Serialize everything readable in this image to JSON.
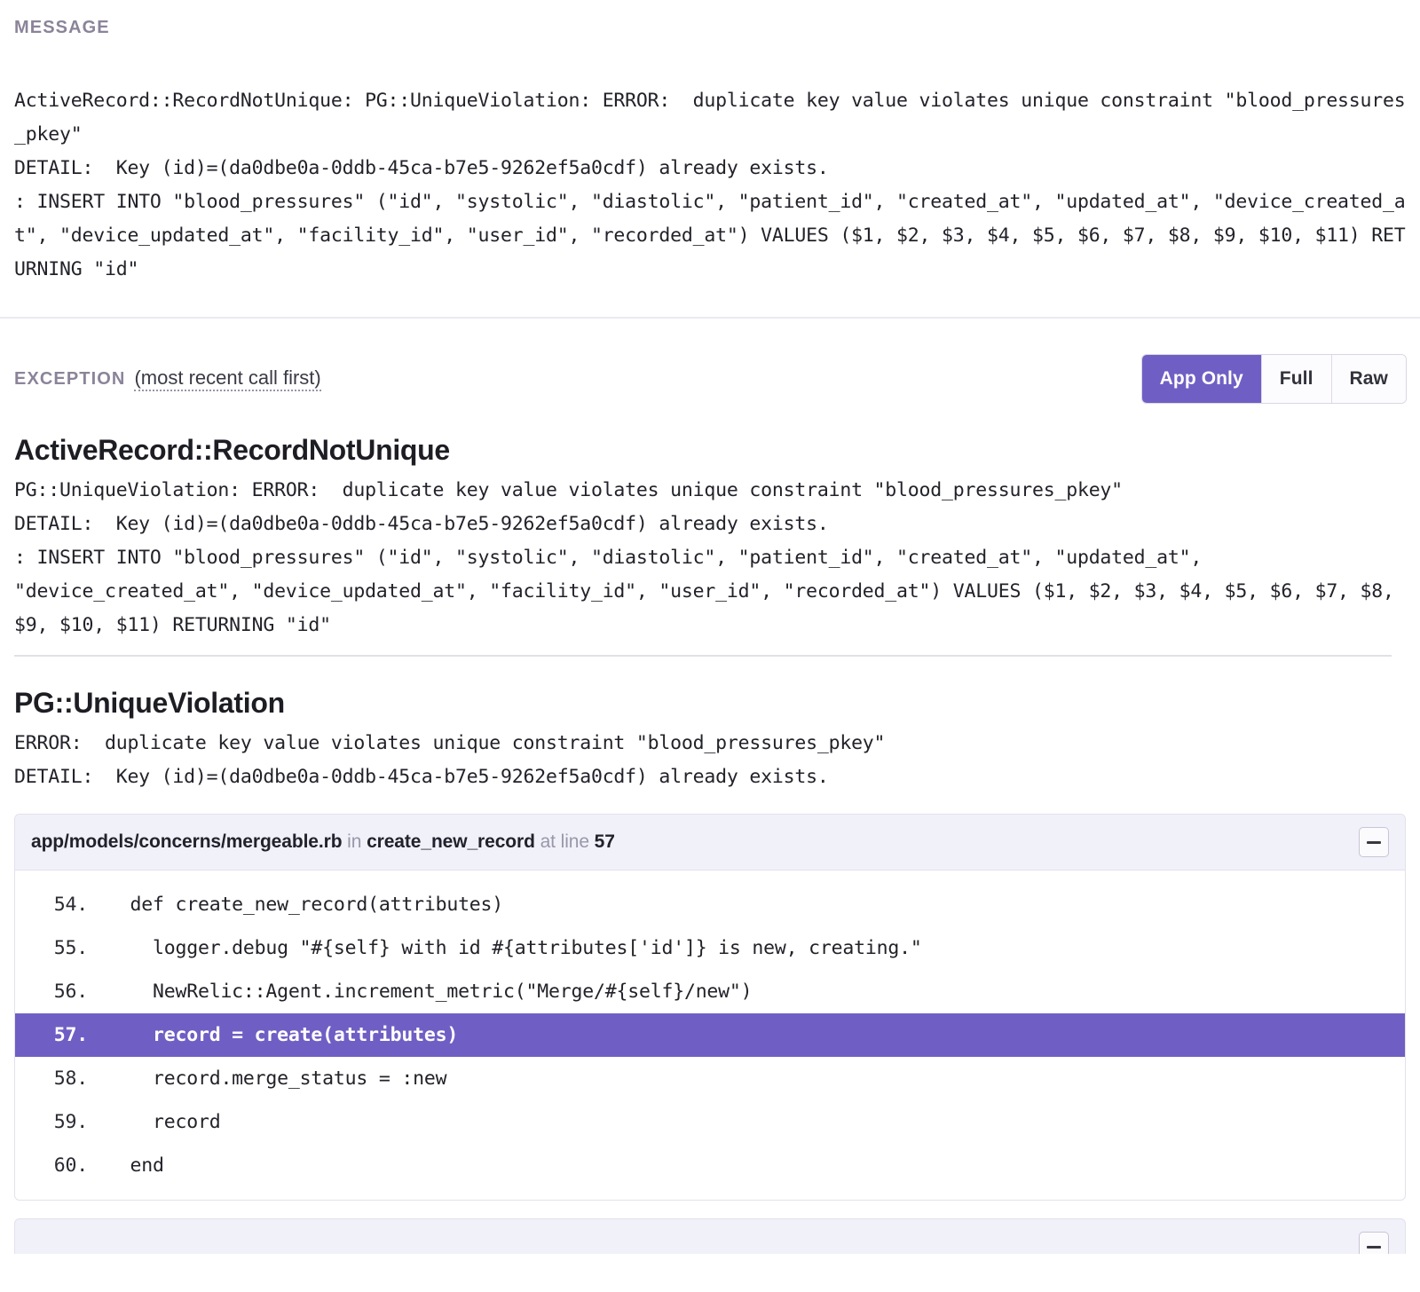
{
  "message_section": {
    "label": "MESSAGE",
    "body": "ActiveRecord::RecordNotUnique: PG::UniqueViolation: ERROR:  duplicate key value violates unique constraint \"blood_pressures_pkey\"\nDETAIL:  Key (id)=(da0dbe0a-0ddb-45ca-b7e5-9262ef5a0cdf) already exists.\n: INSERT INTO \"blood_pressures\" (\"id\", \"systolic\", \"diastolic\", \"patient_id\", \"created_at\", \"updated_at\", \"device_created_at\", \"device_updated_at\", \"facility_id\", \"user_id\", \"recorded_at\") VALUES ($1, $2, $3, $4, $5, $6, $7, $8, $9, $10, $11) RETURNING \"id\""
  },
  "exception_section": {
    "label": "EXCEPTION",
    "subtitle": "(most recent call first)",
    "view_modes": [
      {
        "label": "App Only",
        "active": true
      },
      {
        "label": "Full",
        "active": false
      },
      {
        "label": "Raw",
        "active": false
      }
    ],
    "entries": [
      {
        "title": "ActiveRecord::RecordNotUnique",
        "detail": "PG::UniqueViolation: ERROR:  duplicate key value violates unique constraint \"blood_pressures_pkey\"\nDETAIL:  Key (id)=(da0dbe0a-0ddb-45ca-b7e5-9262ef5a0cdf) already exists.\n: INSERT INTO \"blood_pressures\" (\"id\", \"systolic\", \"diastolic\", \"patient_id\", \"created_at\", \"updated_at\", \"device_created_at\", \"device_updated_at\", \"facility_id\", \"user_id\", \"recorded_at\") VALUES ($1, $2, $3, $4, $5, $6, $7, $8, $9, $10, $11) RETURNING \"id\""
      },
      {
        "title": "PG::UniqueViolation",
        "detail": "ERROR:  duplicate key value violates unique constraint \"blood_pressures_pkey\"\nDETAIL:  Key (id)=(da0dbe0a-0ddb-45ca-b7e5-9262ef5a0cdf) already exists."
      }
    ]
  },
  "frame": {
    "file": "app/models/concerns/mergeable.rb",
    "in_word": "in",
    "method": "create_new_record",
    "at_word": "at line",
    "line": "57",
    "collapse_icon": "minus-icon",
    "code_lines": [
      {
        "number": "54.",
        "source": "  def create_new_record(attributes)",
        "highlight": false
      },
      {
        "number": "55.",
        "source": "    logger.debug \"#{self} with id #{attributes['id']} is new, creating.\"",
        "highlight": false
      },
      {
        "number": "56.",
        "source": "    NewRelic::Agent.increment_metric(\"Merge/#{self}/new\")",
        "highlight": false
      },
      {
        "number": "57.",
        "source": "    record = create(attributes)",
        "highlight": true
      },
      {
        "number": "58.",
        "source": "    record.merge_status = :new",
        "highlight": false
      },
      {
        "number": "59.",
        "source": "    record",
        "highlight": false
      },
      {
        "number": "60.",
        "source": "  end",
        "highlight": false
      }
    ]
  },
  "colors": {
    "accent_purple": "#6f5fc4",
    "label_muted": "#8b8499",
    "frame_header_bg": "#f0f1f9",
    "divider": "#e9e9f1"
  }
}
